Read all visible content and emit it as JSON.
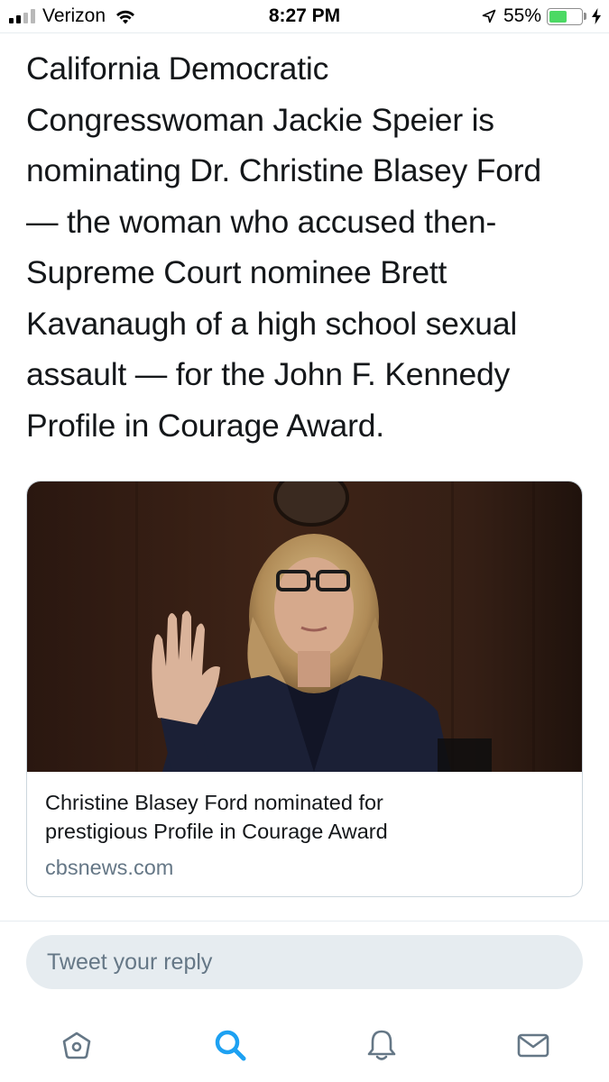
{
  "status_bar": {
    "carrier": "Verizon",
    "time": "8:27 PM",
    "battery_percent": "55%",
    "battery_level": 0.55,
    "signal_bars": 2,
    "icons": [
      "wifi-icon",
      "location-icon",
      "battery-icon",
      "charging-icon"
    ]
  },
  "tweet": {
    "text_lines": [
      "California Democratic",
      "Congresswoman Jackie Speier is",
      "nominating Dr. Christine Blasey Ford",
      "— the woman who accused then-",
      "Supreme Court nominee Brett",
      "Kavanaugh of a high school sexual",
      "assault — for the John F. Kennedy",
      "Profile in Courage Award."
    ]
  },
  "card": {
    "title_lines": [
      "Christine Blasey Ford nominated for",
      "prestigious Profile in Courage Award"
    ],
    "domain": "cbsnews.com"
  },
  "reply": {
    "placeholder": "Tweet your reply"
  },
  "tabbar": {
    "tabs": [
      {
        "name": "home",
        "icon": "home-icon",
        "active": false
      },
      {
        "name": "search",
        "icon": "search-icon",
        "active": true
      },
      {
        "name": "notifications",
        "icon": "bell-icon",
        "active": false
      },
      {
        "name": "messages",
        "icon": "mail-icon",
        "active": false
      }
    ]
  },
  "colors": {
    "accent": "#1da1f2",
    "icon_inactive": "#657786",
    "text": "#14171a",
    "secondary_text": "#657786",
    "battery_green": "#4cd964",
    "reply_bg": "#e6ecf0"
  }
}
